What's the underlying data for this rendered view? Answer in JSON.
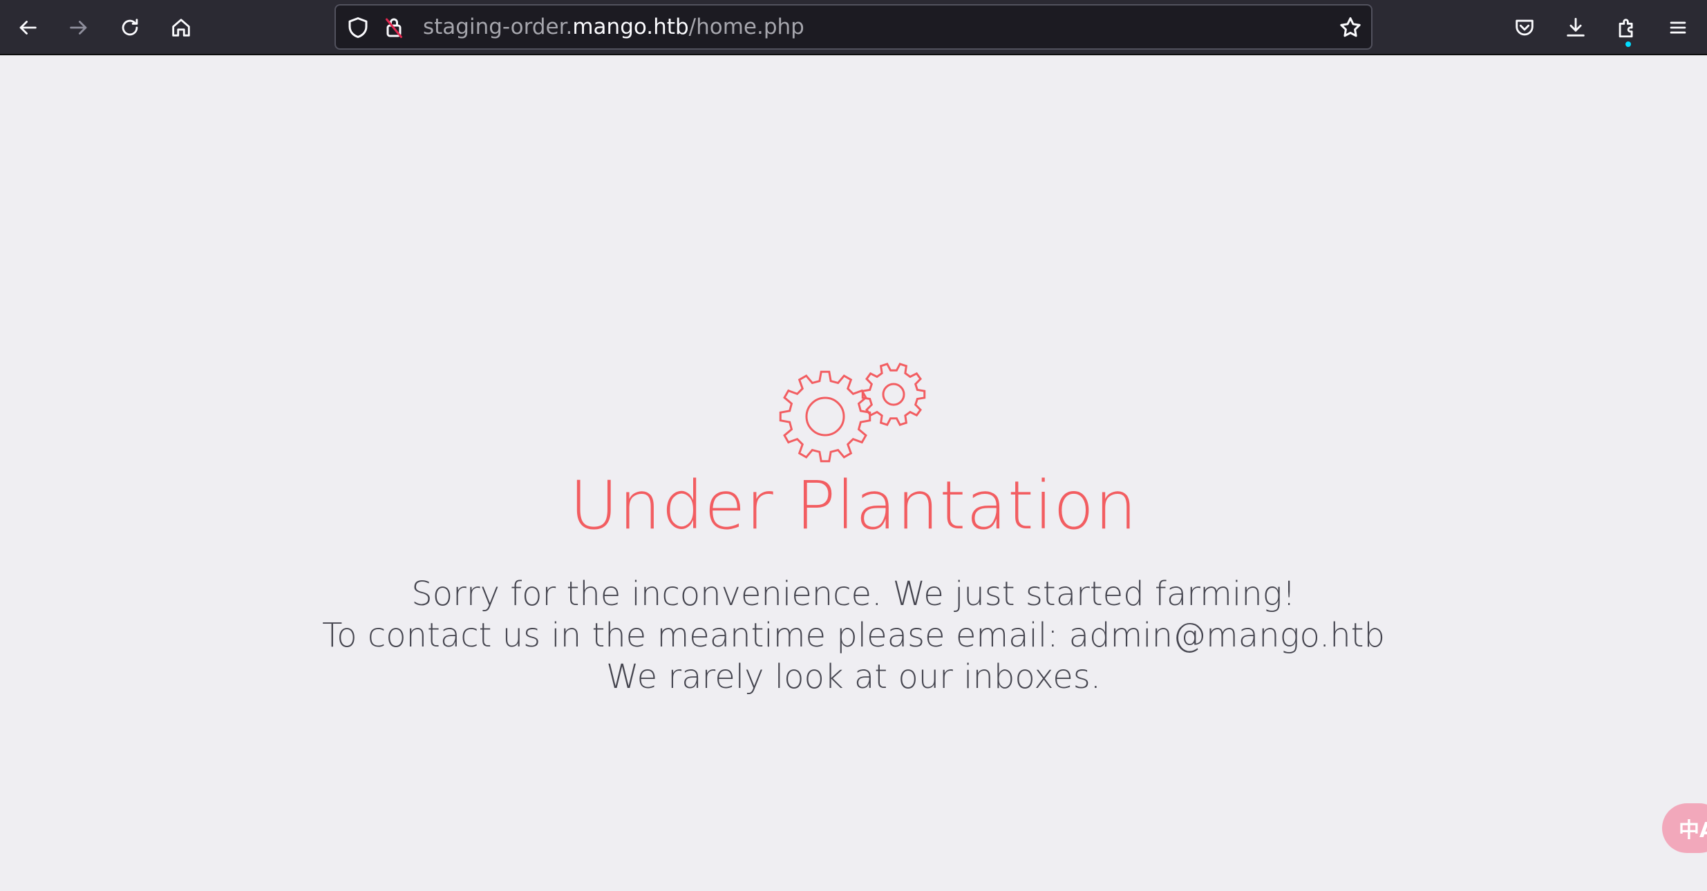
{
  "browser": {
    "url": {
      "prefix": "staging-order.",
      "host": "mango.htb",
      "path": "/home.php"
    },
    "icons": {
      "back": "back-arrow-icon",
      "forward": "forward-arrow-icon",
      "reload": "reload-icon",
      "home": "home-icon",
      "tracking": "shield-icon",
      "insecure": "insecure-lock-icon",
      "bookmark": "star-icon",
      "pocket": "pocket-icon",
      "downloads": "download-icon",
      "extensions": "puzzle-icon",
      "menu": "hamburger-menu-icon"
    },
    "colors": {
      "toolbar": "#2b2a33",
      "urlbar": "#1c1b22"
    }
  },
  "page": {
    "title": "Under Plantation",
    "lines": [
      "Sorry for the inconvenience. We just started farming!",
      "To contact us in the meantime please email: admin@mango.htb",
      "We rarely look at our inboxes."
    ],
    "icon": "gears-icon",
    "colors": {
      "accent": "#f25d61",
      "text": "#45454f",
      "background": "#efeef2"
    }
  },
  "translate_button": {
    "label": "中A",
    "icon": "translate-icon"
  }
}
